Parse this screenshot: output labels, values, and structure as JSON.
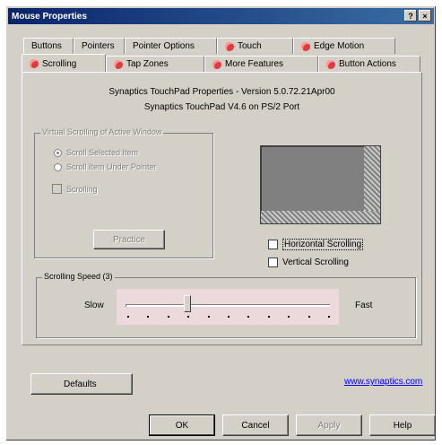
{
  "window": {
    "title": "Mouse Properties",
    "help_btn": "?",
    "close_btn": "×"
  },
  "tabs_back": [
    {
      "label": "Buttons",
      "icon": ""
    },
    {
      "label": "Pointers",
      "icon": ""
    },
    {
      "label": "Pointer Options",
      "icon": ""
    },
    {
      "label": "Touch",
      "icon": "touchpad-icon"
    },
    {
      "label": "Edge Motion",
      "icon": "touchpad-icon"
    }
  ],
  "tabs_front": [
    {
      "label": "Scrolling",
      "icon": "touchpad-icon",
      "active": true
    },
    {
      "label": "Tap Zones",
      "icon": "touchpad-icon"
    },
    {
      "label": "More Features",
      "icon": "touchpad-icon"
    },
    {
      "label": "Button Actions",
      "icon": "touchpad-icon"
    }
  ],
  "info": {
    "line1": "Synaptics TouchPad Properties - Version 5.0.72.21Apr00",
    "line2": "Synaptics TouchPad V4.6 on PS/2 Port"
  },
  "virtual_group": {
    "title": "Virtual Scrolling of Active Window",
    "radio1": "Scroll Selected Item",
    "radio2": "Scroll Item Under Pointer",
    "checkbox": "Scrolling",
    "practice": "Practice"
  },
  "options": {
    "horizontal": "Horizontal Scrolling",
    "vertical": "Vertical Scrolling"
  },
  "speed": {
    "title": "Scrolling Speed (3)",
    "slow": "Slow",
    "fast": "Fast",
    "value": 3,
    "max": 10
  },
  "defaults_btn": "Defaults",
  "link": "www.synaptics.com",
  "footer": {
    "ok": "OK",
    "cancel": "Cancel",
    "apply": "Apply",
    "help": "Help"
  }
}
